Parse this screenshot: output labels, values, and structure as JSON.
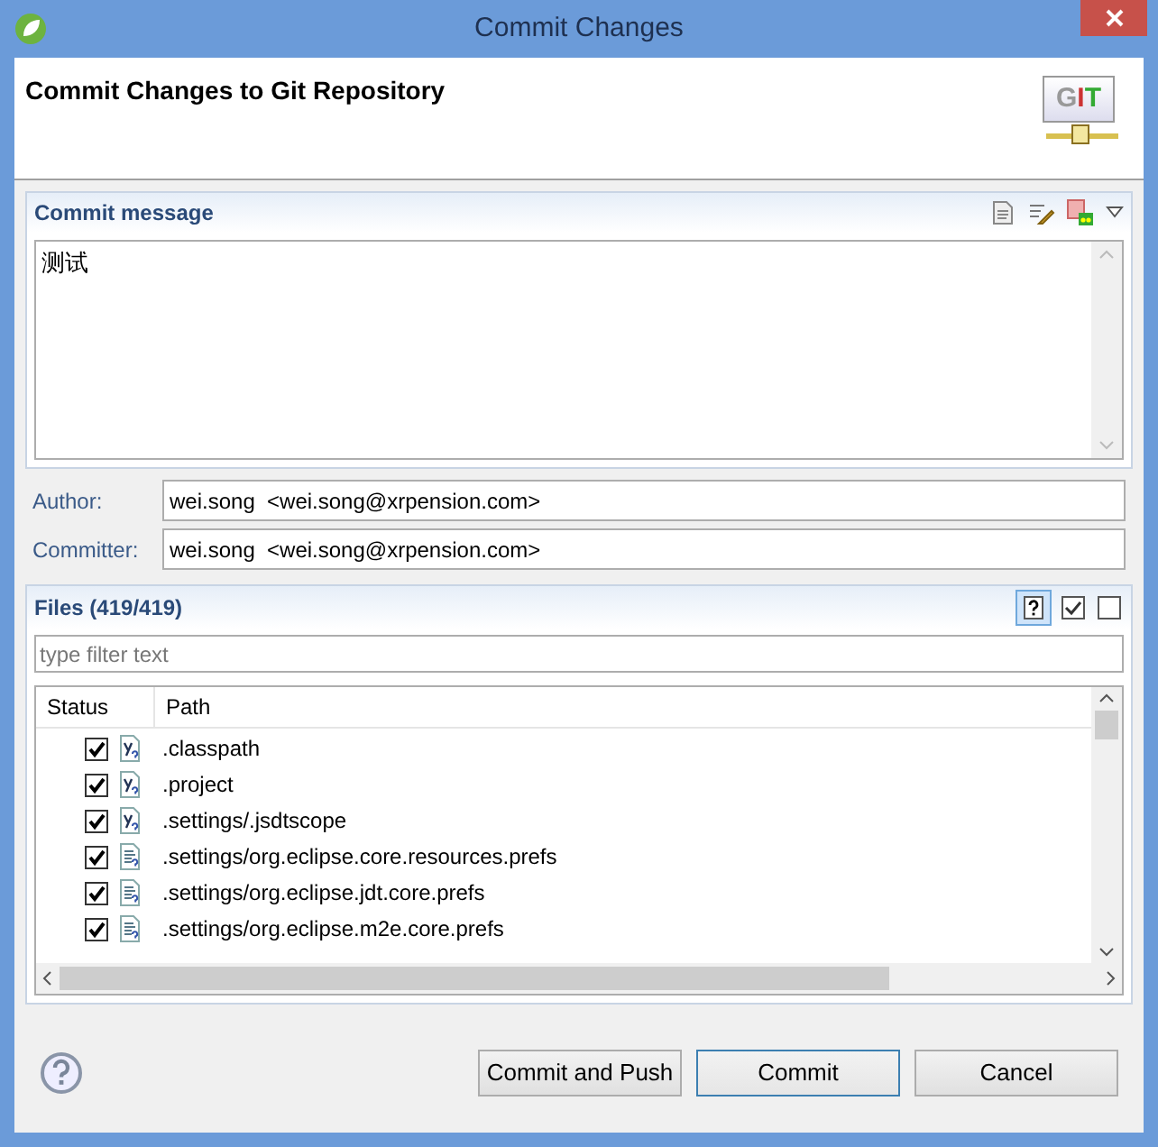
{
  "window": {
    "title": "Commit Changes"
  },
  "header": {
    "title": "Commit Changes to Git Repository",
    "logo_text": "GIT"
  },
  "commit_message": {
    "title": "Commit message",
    "value": "测试"
  },
  "author": {
    "label": "Author:",
    "value": "wei.song  <wei.song@xrpension.com>"
  },
  "committer": {
    "label": "Committer:",
    "value": "wei.song  <wei.song@xrpension.com>"
  },
  "files": {
    "title": "Files (419/419)",
    "show_untracked": true,
    "filter": {
      "placeholder": "type filter text"
    },
    "columns": [
      "Status",
      "Path"
    ],
    "rows": [
      {
        "path": ".classpath",
        "checked": true,
        "kind": "untracked"
      },
      {
        "path": ".project",
        "checked": true,
        "kind": "untracked"
      },
      {
        "path": ".settings/.jsdtscope",
        "checked": true,
        "kind": "untracked"
      },
      {
        "path": ".settings/org.eclipse.core.resources.prefs",
        "checked": true,
        "kind": "prefs"
      },
      {
        "path": ".settings/org.eclipse.jdt.core.prefs",
        "checked": true,
        "kind": "prefs"
      },
      {
        "path": ".settings/org.eclipse.m2e.core.prefs",
        "checked": true,
        "kind": "prefs"
      }
    ]
  },
  "buttons": [
    {
      "label": "Commit and Push",
      "default": false
    },
    {
      "label": "Commit",
      "default": true
    },
    {
      "label": "Cancel",
      "default": false
    }
  ]
}
